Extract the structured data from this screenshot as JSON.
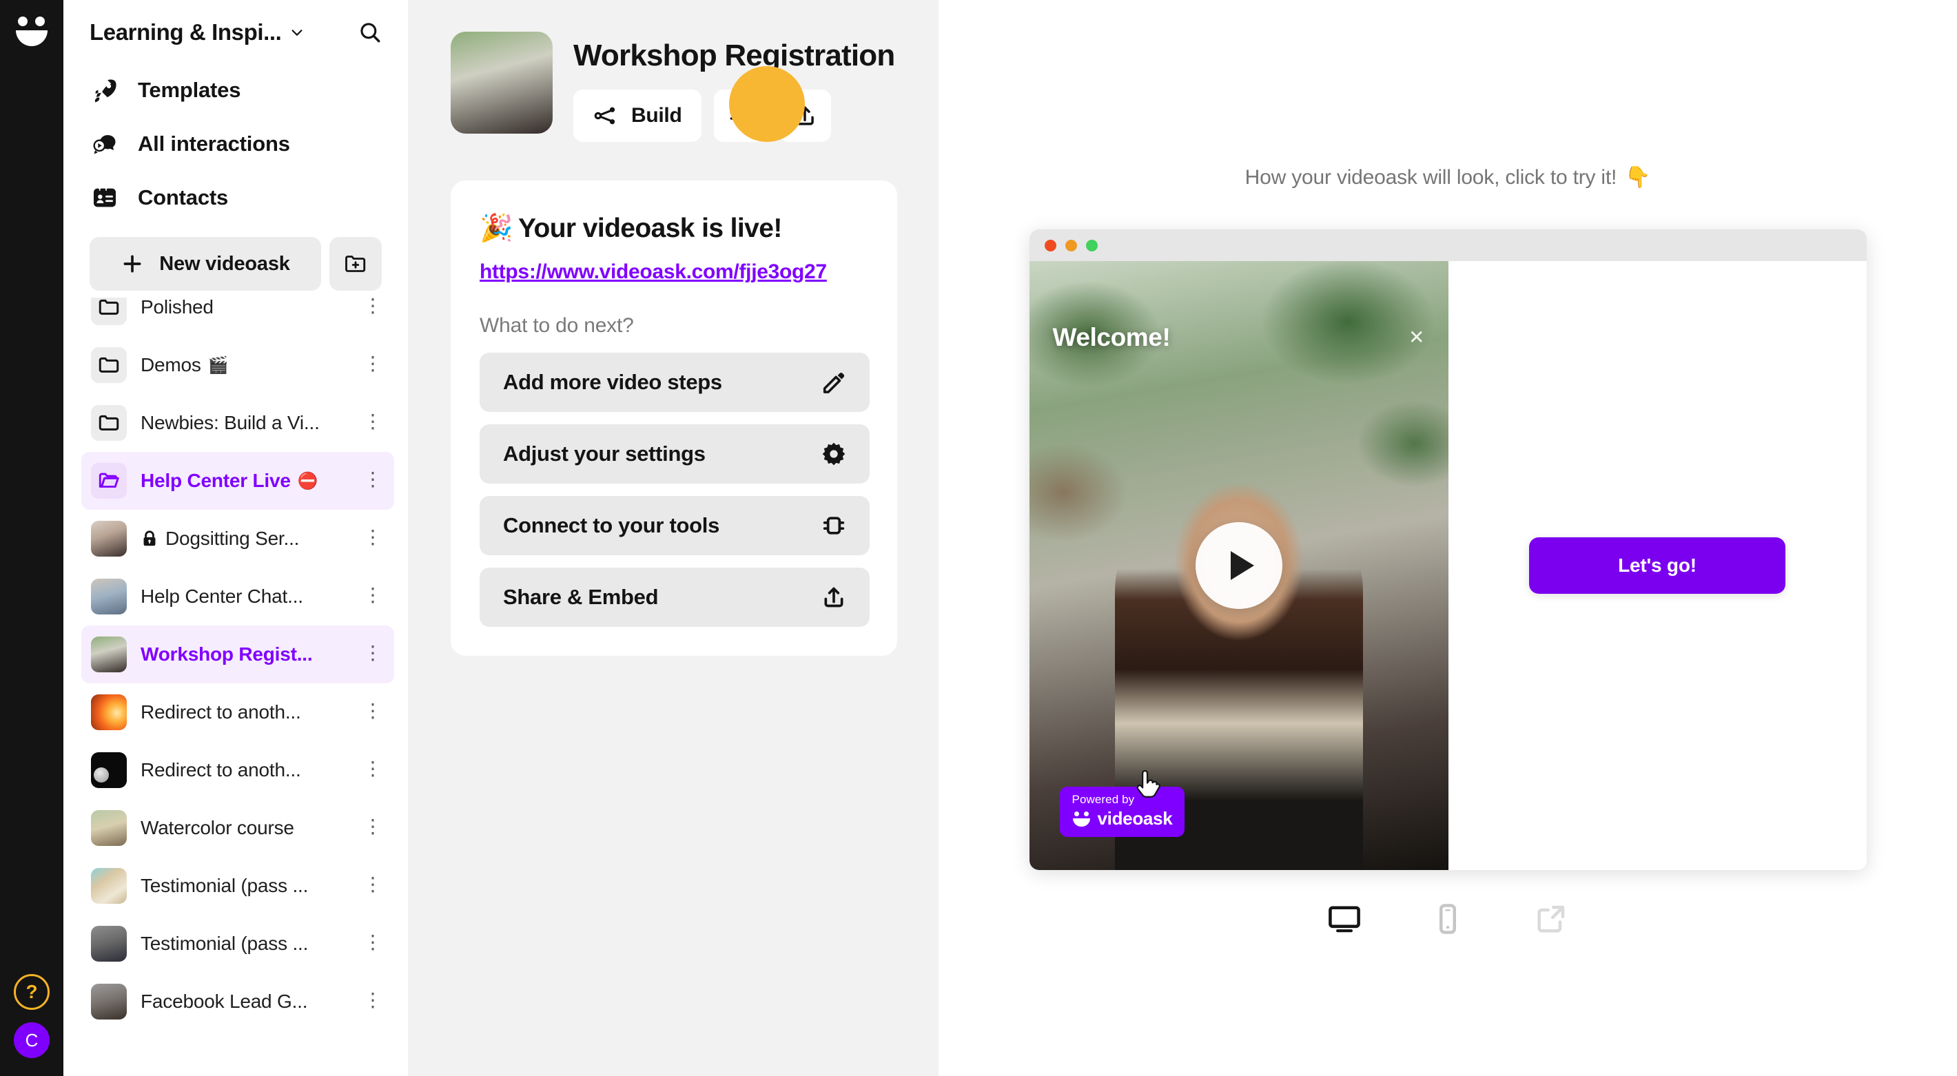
{
  "rail": {
    "logo_icon": "videoask-smile-logo",
    "help_button": {
      "label": "?",
      "icon": "question-mark-icon",
      "color": "#F5B324"
    },
    "avatar": {
      "initial": "C",
      "color": "#8000FF"
    }
  },
  "sidebar": {
    "workspace_name": "Learning & Inspi...",
    "workspace_chevron_icon": "chevron-down-icon",
    "search_icon": "search-icon",
    "nav": [
      {
        "label": "Templates",
        "icon": "rocket-icon"
      },
      {
        "label": "All interactions",
        "icon": "video-chat-bubble-icon"
      },
      {
        "label": "Contacts",
        "icon": "contacts-card-icon"
      }
    ],
    "new_videoask_label": "New videoask",
    "new_videoask_icon": "plus-icon",
    "new_folder_icon": "folder-plus-icon",
    "tree": [
      {
        "label": "Polished",
        "emoji": "",
        "type": "folder",
        "thumb": "tb-pol",
        "active": false,
        "locked": false,
        "clipped": true
      },
      {
        "label": "Demos",
        "emoji": "🎬",
        "type": "folder",
        "thumb": "",
        "active": false,
        "locked": false
      },
      {
        "label": "Newbies: Build a Vi...",
        "emoji": "",
        "type": "folder",
        "thumb": "",
        "active": false,
        "locked": false
      },
      {
        "label": "Help Center Live",
        "emoji": "⛔",
        "type": "folder",
        "thumb": "",
        "active": true,
        "locked": false
      },
      {
        "label": "Dogsitting Ser...",
        "emoji": "",
        "type": "video",
        "thumb": "tb-dog",
        "active": false,
        "locked": true
      },
      {
        "label": "Help Center Chat...",
        "emoji": "",
        "type": "video",
        "thumb": "tb-help",
        "active": false,
        "locked": false
      },
      {
        "label": "Workshop Regist...",
        "emoji": "",
        "type": "video",
        "thumb": "tb-work",
        "active": true,
        "locked": false
      },
      {
        "label": "Redirect to anoth...",
        "emoji": "",
        "type": "video",
        "thumb": "tb-sun",
        "active": false,
        "locked": false
      },
      {
        "label": "Redirect to anoth...",
        "emoji": "",
        "type": "video",
        "thumb": "tb-moon",
        "active": false,
        "locked": false
      },
      {
        "label": "Watercolor course",
        "emoji": "",
        "type": "video",
        "thumb": "tb-water",
        "active": false,
        "locked": false
      },
      {
        "label": "Testimonial (pass ...",
        "emoji": "",
        "type": "video",
        "thumb": "tb-tag",
        "active": false,
        "locked": false
      },
      {
        "label": "Testimonial (pass ...",
        "emoji": "",
        "type": "video",
        "thumb": "tb-man",
        "active": false,
        "locked": false
      },
      {
        "label": "Facebook Lead G...",
        "emoji": "",
        "type": "video",
        "thumb": "tb-fb",
        "active": false,
        "locked": false
      }
    ],
    "row_menu_icon": "kebab-menu-icon"
  },
  "main": {
    "title": "Workshop Registration",
    "thumbnail_icon": "videoask-thumbnail",
    "toolbar": {
      "build_label": "Build",
      "build_icon": "flow-nodes-icon",
      "connect_icon": "integrations-plug-icon",
      "share_icon": "share-upload-icon"
    },
    "card": {
      "emoji": "🎉",
      "title": "Your videoask is live!",
      "link": "https://www.videoask.com/fjje3og27",
      "subtitle": "What to do next?",
      "items": [
        {
          "label": "Add more video steps",
          "icon": "pencil-icon"
        },
        {
          "label": "Adjust your settings",
          "icon": "gear-icon"
        },
        {
          "label": "Connect to your tools",
          "icon": "integrations-plug-icon"
        },
        {
          "label": "Share & Embed",
          "icon": "share-upload-icon"
        }
      ]
    }
  },
  "preview": {
    "hint_text": "How your videoask will look, click to try it!",
    "hint_emoji": "👇",
    "browser_dots": [
      "#EF4B23",
      "#EE9A22",
      "#41D15C"
    ],
    "video": {
      "overlay_title": "Welcome!",
      "close_icon": "close-x-icon",
      "play_icon": "play-icon",
      "badge_top": "Powered by",
      "badge_word": "videoask",
      "badge_color": "#8000FF",
      "cursor_icon": "pointing-hand-cursor"
    },
    "cta_label": "Let's go!",
    "cta_color": "#7C00F0",
    "devices": [
      {
        "icon": "desktop-icon",
        "active": true
      },
      {
        "icon": "mobile-icon",
        "active": false
      },
      {
        "icon": "external-link-icon",
        "active": false
      }
    ]
  }
}
